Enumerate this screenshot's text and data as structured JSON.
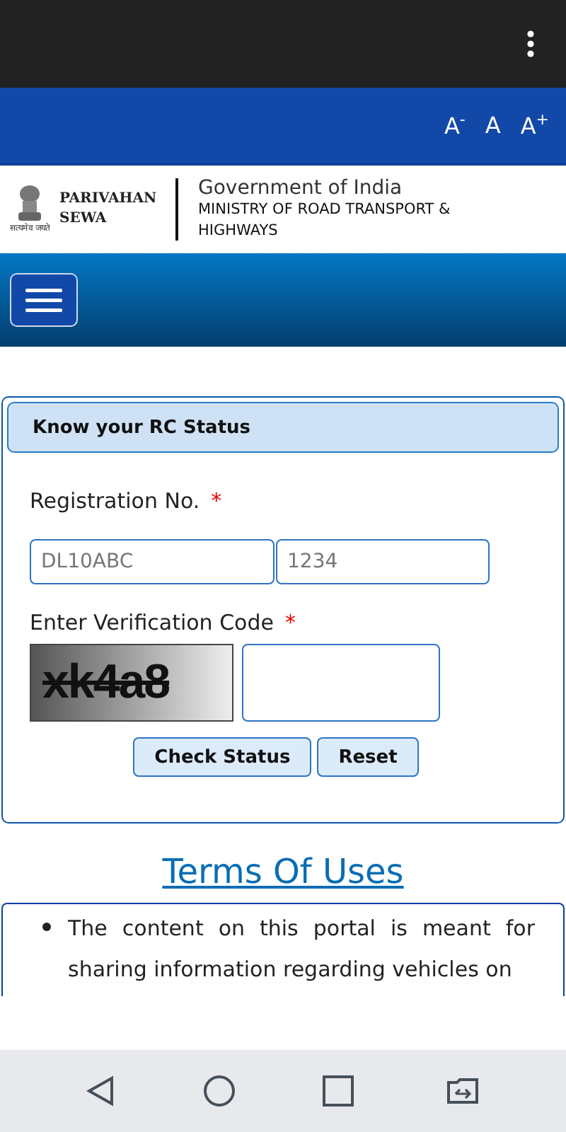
{
  "font_controls": [
    "A$^{-}$",
    "A",
    "A$^{+}$"
  ],
  "header": {
    "brand": [
      "PARIVAHAN",
      "SEWA"
    ],
    "emblem_caption": "सत्यमेव जयते",
    "org": "Government of India",
    "ministry": "MINISTRY OF ROAD TRANSPORT & HIGHWAYS"
  },
  "form": {
    "title": "Know your RC Status",
    "registration_label": "Registration No.",
    "required_mark": "*",
    "fields": [
      {
        "placeholder": "DL10ABC"
      },
      {
        "placeholder": "1234"
      }
    ],
    "code_label": "Enter Verification Code",
    "code_required_mark": "*",
    "captcha": "xk4a8",
    "buttons": [
      "Check Status",
      "Reset"
    ]
  },
  "terms": {
    "title": "Terms Of Uses",
    "items": [
      "The content on this portal is meant for sharing information regarding vehicles on"
    ]
  }
}
